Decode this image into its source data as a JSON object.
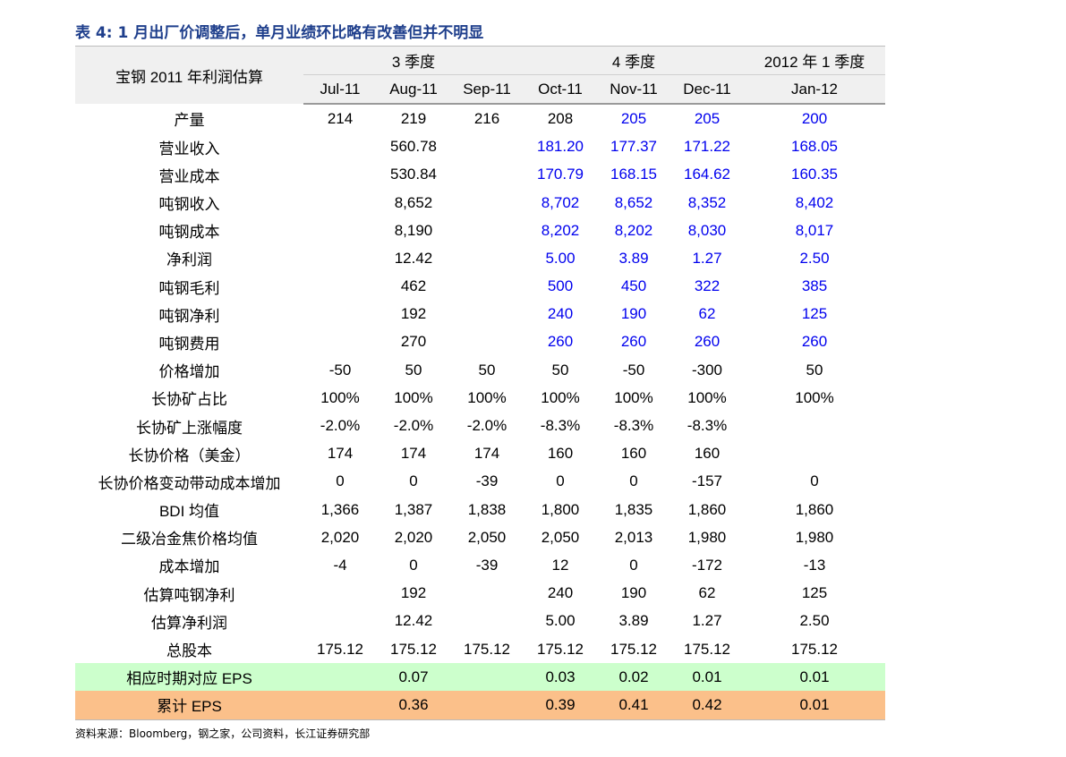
{
  "title": "表 4:  1 月出厂价调整后，单月业绩环比略有改善但并不明显",
  "header": {
    "corner": "宝钢 2011 年利润估算",
    "groups": [
      "3 季度",
      "4 季度",
      "2012 年 1 季度"
    ],
    "months": [
      "Jul-11",
      "Aug-11",
      "Sep-11",
      "Oct-11",
      "Nov-11",
      "Dec-11",
      "Jan-12"
    ]
  },
  "rows": [
    {
      "label": "产量",
      "values": [
        "214",
        "219",
        "216",
        "208",
        "205",
        "205",
        "200"
      ]
    },
    {
      "label": "营业收入",
      "values": [
        "",
        "560.78",
        "",
        "181.20",
        "177.37",
        "171.22",
        "168.05"
      ]
    },
    {
      "label": "营业成本",
      "values": [
        "",
        "530.84",
        "",
        "170.79",
        "168.15",
        "164.62",
        "160.35"
      ]
    },
    {
      "label": "吨钢收入",
      "values": [
        "",
        "8,652",
        "",
        "8,702",
        "8,652",
        "8,352",
        "8,402"
      ]
    },
    {
      "label": "吨钢成本",
      "values": [
        "",
        "8,190",
        "",
        "8,202",
        "8,202",
        "8,030",
        "8,017"
      ]
    },
    {
      "label": "净利润",
      "values": [
        "",
        "12.42",
        "",
        "5.00",
        "3.89",
        "1.27",
        "2.50"
      ]
    },
    {
      "label": "吨钢毛利",
      "values": [
        "",
        "462",
        "",
        "500",
        "450",
        "322",
        "385"
      ]
    },
    {
      "label": "吨钢净利",
      "values": [
        "",
        "192",
        "",
        "240",
        "190",
        "62",
        "125"
      ]
    },
    {
      "label": "吨钢费用",
      "values": [
        "",
        "270",
        "",
        "260",
        "260",
        "260",
        "260"
      ]
    },
    {
      "label": "价格增加",
      "values": [
        "-50",
        "50",
        "50",
        "50",
        "-50",
        "-300",
        "50"
      ]
    },
    {
      "label": "长协矿占比",
      "values": [
        "100%",
        "100%",
        "100%",
        "100%",
        "100%",
        "100%",
        "100%"
      ]
    },
    {
      "label": "长协矿上涨幅度",
      "values": [
        "-2.0%",
        "-2.0%",
        "-2.0%",
        "-8.3%",
        "-8.3%",
        "-8.3%",
        ""
      ]
    },
    {
      "label": "长协价格（美金）",
      "values": [
        "174",
        "174",
        "174",
        "160",
        "160",
        "160",
        ""
      ]
    },
    {
      "label": "长协价格变动带动成本增加",
      "values": [
        "0",
        "0",
        "-39",
        "0",
        "0",
        "-157",
        "0"
      ]
    },
    {
      "label": "BDI 均值",
      "values": [
        "1,366",
        "1,387",
        "1,838",
        "1,800",
        "1,835",
        "1,860",
        "1,860"
      ]
    },
    {
      "label": "二级冶金焦价格均值",
      "values": [
        "2,020",
        "2,020",
        "2,050",
        "2,050",
        "2,013",
        "1,980",
        "1,980"
      ]
    },
    {
      "label": "成本增加",
      "values": [
        "-4",
        "0",
        "-39",
        "12",
        "0",
        "-172",
        "-13"
      ]
    },
    {
      "label": "估算吨钢净利",
      "values": [
        "",
        "192",
        "",
        "240",
        "190",
        "62",
        "125"
      ]
    },
    {
      "label": "估算净利润",
      "values": [
        "",
        "12.42",
        "",
        "5.00",
        "3.89",
        "1.27",
        "2.50"
      ]
    },
    {
      "label": "总股本",
      "values": [
        "175.12",
        "175.12",
        "175.12",
        "175.12",
        "175.12",
        "175.12",
        "175.12"
      ]
    },
    {
      "label": "相应时期对应 EPS",
      "values": [
        "",
        "0.07",
        "",
        "0.03",
        "0.02",
        "0.01",
        "0.01"
      ]
    },
    {
      "label": "累计 EPS",
      "values": [
        "",
        "0.36",
        "",
        "0.39",
        "0.41",
        "0.42",
        "0.01"
      ]
    }
  ],
  "colors": {
    "title": "#1f3f8c",
    "estimate_blue": "#0000ee",
    "eps_row": "#ccffcc",
    "cumulative_eps_row": "#fbc08a",
    "header_bg": "#f0f0f0"
  },
  "source": "资料来源：Bloomberg，钢之家，公司资料，长江证券研究部"
}
